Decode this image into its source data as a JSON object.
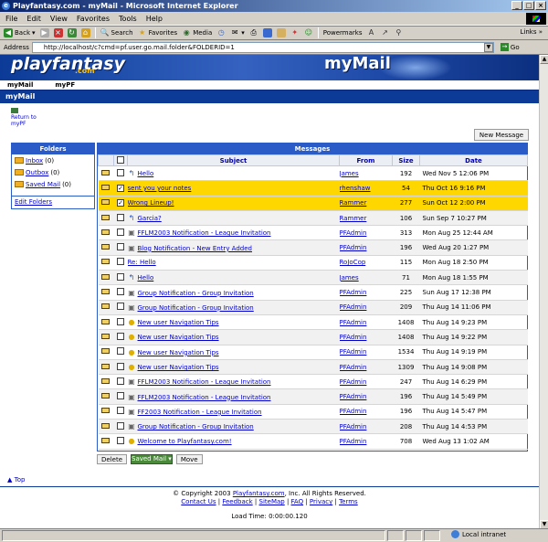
{
  "window": {
    "title": "Playfantasy.com - myMail - Microsoft Internet Explorer"
  },
  "menu": [
    "File",
    "Edit",
    "View",
    "Favorites",
    "Tools",
    "Help"
  ],
  "toolbar": {
    "back": "Back",
    "search": "Search",
    "favorites": "Favorites",
    "media": "Media",
    "powermarks": "Powermarks",
    "links": "Links"
  },
  "address": {
    "label": "Address",
    "url": "http://localhost/c?cmd=pf.user.go.mail.folder&FOLDERID=1",
    "go": "Go"
  },
  "banner": {
    "logo": "playfantasy",
    "logo_sub": ".com",
    "title": "myMail"
  },
  "subnav": [
    "myMail",
    "myPF"
  ],
  "page_header": "myMail",
  "return_link": "Return to myPF",
  "new_message": "New Message",
  "folders": {
    "title": "Folders",
    "items": [
      {
        "name": "Inbox",
        "count": "(0)"
      },
      {
        "name": "Outbox",
        "count": "(0)"
      },
      {
        "name": "Saved Mail",
        "count": "(0)"
      }
    ],
    "edit": "Edit Folders"
  },
  "messages": {
    "title": "Messages",
    "columns": {
      "subject": "Subject",
      "from": "From",
      "size": "Size",
      "date": "Date"
    },
    "rows": [
      {
        "icon": "reply",
        "subject": "Hello",
        "from": "James",
        "size": "192",
        "date": "Wed Nov 5 12:06 PM",
        "checked": false,
        "highlight": false
      },
      {
        "icon": "none",
        "subject": "sent you your notes",
        "from": "rhenshaw",
        "size": "54",
        "date": "Thu Oct 16 9:16 PM",
        "checked": true,
        "highlight": true
      },
      {
        "icon": "none",
        "subject": "Wrong Lineup!",
        "from": "Rammer",
        "size": "277",
        "date": "Sun Oct 12 2:00 PM",
        "checked": true,
        "highlight": true
      },
      {
        "icon": "reply",
        "subject": "Garcia?",
        "from": "Rammer",
        "size": "106",
        "date": "Sun Sep 7 10:27 PM",
        "checked": false,
        "highlight": false
      },
      {
        "icon": "notify",
        "subject": "FFLM2003 Notification - League Invitation",
        "from": "PFAdmin",
        "size": "313",
        "date": "Mon Aug 25 12:44 AM",
        "checked": false,
        "highlight": false
      },
      {
        "icon": "notify",
        "subject": "Blog Notification - New Entry Added",
        "from": "PFAdmin",
        "size": "196",
        "date": "Wed Aug 20 1:27 PM",
        "checked": false,
        "highlight": false
      },
      {
        "icon": "none",
        "subject": "Re: Hello",
        "from": "RoJoCop",
        "size": "115",
        "date": "Mon Aug 18 2:50 PM",
        "checked": false,
        "highlight": false
      },
      {
        "icon": "reply",
        "subject": "Hello",
        "from": "James",
        "size": "71",
        "date": "Mon Aug 18 1:55 PM",
        "checked": false,
        "highlight": false
      },
      {
        "icon": "notify",
        "subject": "Group Notification - Group Invitation",
        "from": "PFAdmin",
        "size": "225",
        "date": "Sun Aug 17 12:38 PM",
        "checked": false,
        "highlight": false
      },
      {
        "icon": "notify",
        "subject": "Group Notification - Group Invitation",
        "from": "PFAdmin",
        "size": "209",
        "date": "Thu Aug 14 11:06 PM",
        "checked": false,
        "highlight": false
      },
      {
        "icon": "tip",
        "subject": "New user Navigation Tips",
        "from": "PFAdmin",
        "size": "1408",
        "date": "Thu Aug 14 9:23 PM",
        "checked": false,
        "highlight": false
      },
      {
        "icon": "tip",
        "subject": "New user Navigation Tips",
        "from": "PFAdmin",
        "size": "1408",
        "date": "Thu Aug 14 9:22 PM",
        "checked": false,
        "highlight": false
      },
      {
        "icon": "tip",
        "subject": "New user Navigation Tips",
        "from": "PFAdmin",
        "size": "1534",
        "date": "Thu Aug 14 9:19 PM",
        "checked": false,
        "highlight": false
      },
      {
        "icon": "tip",
        "subject": "New user Navigation Tips",
        "from": "PFAdmin",
        "size": "1309",
        "date": "Thu Aug 14 9:08 PM",
        "checked": false,
        "highlight": false
      },
      {
        "icon": "notify",
        "subject": "FFLM2003 Notification - League Invitation",
        "from": "PFAdmin",
        "size": "247",
        "date": "Thu Aug 14 6:29 PM",
        "checked": false,
        "highlight": false
      },
      {
        "icon": "notify",
        "subject": "FFLM2003 Notification - League Invitation",
        "from": "PFAdmin",
        "size": "196",
        "date": "Thu Aug 14 5:49 PM",
        "checked": false,
        "highlight": false
      },
      {
        "icon": "notify",
        "subject": "FF2003 Notification - League Invitation",
        "from": "PFAdmin",
        "size": "196",
        "date": "Thu Aug 14 5:47 PM",
        "checked": false,
        "highlight": false
      },
      {
        "icon": "notify",
        "subject": "Group Notification - Group Invitation",
        "from": "PFAdmin",
        "size": "208",
        "date": "Thu Aug 14 4:53 PM",
        "checked": false,
        "highlight": false
      },
      {
        "icon": "tip",
        "subject": "Welcome to Playfantasy.com!",
        "from": "PFAdmin",
        "size": "708",
        "date": "Wed Aug 13 1:02 AM",
        "checked": false,
        "highlight": false
      }
    ]
  },
  "bottom": {
    "delete": "Delete",
    "folder_select": "Saved Mail",
    "move": "Move"
  },
  "top_link": "Top",
  "footer": {
    "copyright_pre": "© Copyright 2003",
    "copyright_link": "Playfantasy.com",
    "copyright_post": ", Inc. All Rights Reserved.",
    "links": [
      "Contact Us",
      "Feedback",
      "SiteMap",
      "FAQ",
      "Privacy",
      "Terms"
    ],
    "load_time": "Load Time: 0:00:00.120"
  },
  "status": {
    "zone": "Local intranet"
  },
  "colors": {
    "highlight": "#ffd700",
    "panel_blue": "#2a5bc7",
    "banner_blue": "#0b3b97",
    "link": "#0000cc"
  }
}
